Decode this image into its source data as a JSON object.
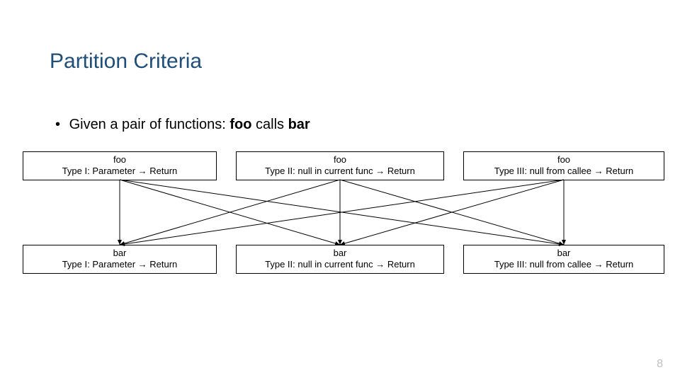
{
  "slide": {
    "title": "Partition Criteria",
    "bullet_prefix": "Given a pair of functions: ",
    "bullet_foo": "foo",
    "bullet_middle": " calls ",
    "bullet_bar": "bar",
    "page_number": "8"
  },
  "arrow_glyph": "→",
  "top_boxes": [
    {
      "fn": "foo",
      "desc_pre": "Type I: Parameter ",
      "desc_post": " Return"
    },
    {
      "fn": "foo",
      "desc_pre": "Type II: null in current func ",
      "desc_post": " Return"
    },
    {
      "fn": "foo",
      "desc_pre": "Type III: null from callee ",
      "desc_post": " Return"
    }
  ],
  "bottom_boxes": [
    {
      "fn": "bar",
      "desc_pre": "Type I: Parameter ",
      "desc_post": " Return"
    },
    {
      "fn": "bar",
      "desc_pre": "Type II: null in current func ",
      "desc_post": " Return"
    },
    {
      "fn": "bar",
      "desc_pre": "Type III: null from callee ",
      "desc_post": " Return"
    }
  ]
}
